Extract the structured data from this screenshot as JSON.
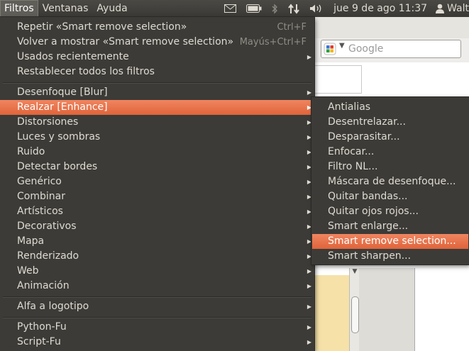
{
  "topbar": {
    "menus": [
      "Filtros",
      "Ventanas",
      "Ayuda"
    ],
    "clock": "jue  9 de ago 11:37",
    "user": "Walt"
  },
  "background_window": {
    "search_placeholder": "Google"
  },
  "filters_menu": {
    "items": [
      {
        "label": "Repetir «Smart remove selection»",
        "accel": "Ctrl+F"
      },
      {
        "label": "Volver a mostrar «Smart remove selection»",
        "accel": "Mayús+Ctrl+F"
      },
      {
        "label": "Usados recientemente"
      },
      {
        "label": "Restablecer todos los filtros"
      },
      {
        "label": "Desenfoque [Blur]"
      },
      {
        "label": "Realzar [Enhance]"
      },
      {
        "label": "Distorsiones"
      },
      {
        "label": "Luces y sombras"
      },
      {
        "label": "Ruido"
      },
      {
        "label": "Detectar bordes"
      },
      {
        "label": "Genérico"
      },
      {
        "label": "Combinar"
      },
      {
        "label": "Artísticos"
      },
      {
        "label": "Decorativos"
      },
      {
        "label": "Mapa"
      },
      {
        "label": "Renderizado"
      },
      {
        "label": "Web"
      },
      {
        "label": "Animación"
      },
      {
        "label": "Alfa a logotipo"
      },
      {
        "label": "Python-Fu"
      },
      {
        "label": "Script-Fu"
      }
    ]
  },
  "enhance_submenu": {
    "items": [
      "Antialias",
      "Desentrelazar...",
      "Desparasitar...",
      "Enfocar...",
      "Filtro NL...",
      "Máscara de desenfoque...",
      "Quitar bandas...",
      "Quitar ojos rojos...",
      "Smart enlarge...",
      "Smart remove selection...",
      "Smart sharpen..."
    ]
  },
  "colors": {
    "menu_bg": "#3c3b37",
    "highlight": "#e8703f",
    "text": "#dfdbd2"
  }
}
